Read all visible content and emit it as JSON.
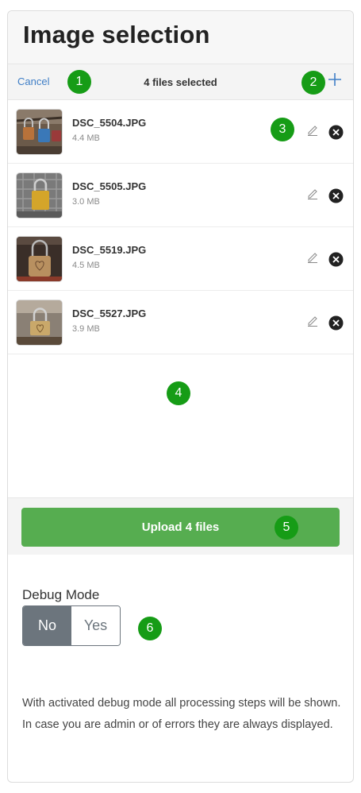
{
  "header": {
    "title": "Image selection"
  },
  "toolbar": {
    "cancel_label": "Cancel",
    "count_label": "4 files selected",
    "add_icon": "plus-icon"
  },
  "files": [
    {
      "name": "DSC_5504.JPG",
      "size": "4.4 MB"
    },
    {
      "name": "DSC_5505.JPG",
      "size": "3.0 MB"
    },
    {
      "name": "DSC_5519.JPG",
      "size": "4.5 MB"
    },
    {
      "name": "DSC_5527.JPG",
      "size": "3.9 MB"
    }
  ],
  "footer": {
    "upload_label": "Upload 4 files"
  },
  "debug": {
    "label": "Debug Mode",
    "options": [
      "No",
      "Yes"
    ],
    "selected": "No",
    "description": "With activated debug mode all processing steps will be shown. In case you are admin or of errors they are always displayed."
  },
  "annotations": [
    "1",
    "2",
    "3",
    "4",
    "5",
    "6"
  ],
  "colors": {
    "accent": "#3f7ec6",
    "upload": "#56ad50",
    "badge": "#169c16",
    "toggle_active": "#6c757d"
  }
}
